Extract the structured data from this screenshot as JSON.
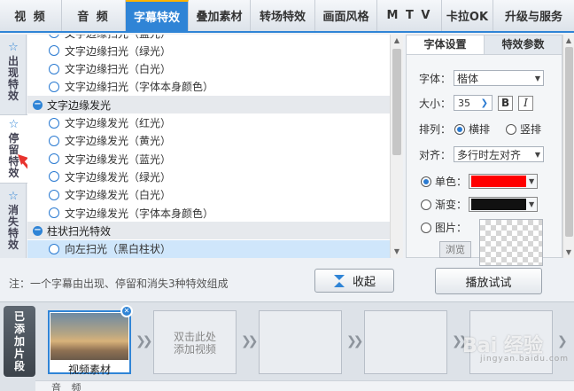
{
  "top_tabs": [
    "视 频",
    "音 频",
    "字幕特效",
    "叠加素材",
    "转场特效",
    "画面风格",
    "M T V",
    "卡拉OK",
    "升级与服务"
  ],
  "side_tabs": [
    {
      "label": "出现特效",
      "icon": "star-plus-icon"
    },
    {
      "label": "停留特效",
      "icon": "star-icon"
    },
    {
      "label": "消失特效",
      "icon": "star-minus-icon"
    }
  ],
  "effects": {
    "rows": [
      {
        "kind": "item",
        "label": "文字边缘扫光（蓝光）"
      },
      {
        "kind": "item",
        "label": "文字边缘扫光（绿光）"
      },
      {
        "kind": "item",
        "label": "文字边缘扫光（白光）"
      },
      {
        "kind": "item",
        "label": "文字边缘扫光（字体本身颜色）"
      },
      {
        "kind": "group",
        "label": "文字边缘发光"
      },
      {
        "kind": "item",
        "label": "文字边缘发光（红光）"
      },
      {
        "kind": "item",
        "label": "文字边缘发光（黄光）"
      },
      {
        "kind": "item",
        "label": "文字边缘发光（蓝光）"
      },
      {
        "kind": "item",
        "label": "文字边缘发光（绿光）"
      },
      {
        "kind": "item",
        "label": "文字边缘发光（白光）"
      },
      {
        "kind": "item",
        "label": "文字边缘发光（字体本身颜色）"
      },
      {
        "kind": "group",
        "label": "柱状扫光特效"
      },
      {
        "kind": "item",
        "label": "向左扫光（黑白柱状）",
        "selected": true
      }
    ]
  },
  "settings": {
    "tabs": [
      "字体设置",
      "特效参数"
    ],
    "font_label": "字体：",
    "font_value": "楷体",
    "size_label": "大小：",
    "size_value": "35",
    "bold_label": "B",
    "italic_label": "I",
    "arrange_label": "排列：",
    "arrange_horizontal": "横排",
    "arrange_vertical": "竖排",
    "align_label": "对齐：",
    "align_value": "多行时左对齐",
    "single_color_label": "单色：",
    "single_color": "#ff0000",
    "gradient_label": "渐变：",
    "gradient_color": "#111111",
    "image_label": "图片：",
    "browse_label": "浏览"
  },
  "footer": {
    "note": "注：一个字幕由出现、停留和消失3种特效组成",
    "collapse_label": "收起",
    "play_label": "播放试试"
  },
  "timeline": {
    "side_label": "已添加片段",
    "clip_caption": "视频素材",
    "empty_hint_line1": "双击此处",
    "empty_hint_line2": "添加视频",
    "audio_label": "音 频"
  },
  "watermark": {
    "main": "Bai 经验",
    "sub": "jingyan.baidu.com"
  },
  "colors": {
    "accent": "#2f84d6",
    "highlight": "#ffb400"
  }
}
